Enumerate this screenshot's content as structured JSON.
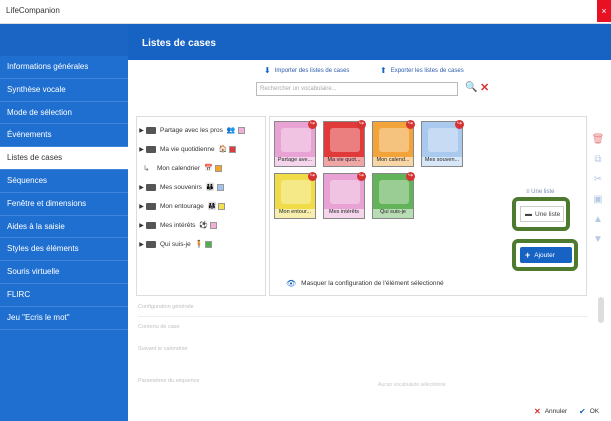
{
  "window": {
    "title": "LifeCompanion",
    "close_glyph": "×"
  },
  "sidebar": {
    "items": [
      {
        "label": "Informations générales",
        "active": false
      },
      {
        "label": "Synthèse vocale",
        "active": false
      },
      {
        "label": "Mode de sélection",
        "active": false
      },
      {
        "label": "Événements",
        "active": false
      },
      {
        "label": "Listes de cases",
        "active": true
      },
      {
        "label": "Séquences",
        "active": false
      },
      {
        "label": "Fenêtre et dimensions",
        "active": false
      },
      {
        "label": "Aides à la saisie",
        "active": false
      },
      {
        "label": "Styles des éléments",
        "active": false
      },
      {
        "label": "Souris virtuelle",
        "active": false
      },
      {
        "label": "FLIRC",
        "active": false
      },
      {
        "label": "Jeu \"Ecris le mot\"",
        "active": false
      }
    ]
  },
  "header": {
    "title": "Listes de cases"
  },
  "toolbar": {
    "import_label": "Importer des listes de cases",
    "export_label": "Exporter les listes de cases"
  },
  "search": {
    "placeholder": "Rechercher un vocabulaire..."
  },
  "tree": {
    "items": [
      {
        "label": "Partage avec les pros",
        "color": "#f2b0d9",
        "has_children": true,
        "fig": "👥"
      },
      {
        "label": "Ma vie quotidienne",
        "color": "#e03a3a",
        "has_children": true,
        "fig": "🏠"
      },
      {
        "label": "Mon calendrier",
        "color": "#f5a623",
        "has_children": false,
        "fig": "📅"
      },
      {
        "label": "Mes souvenirs",
        "color": "#9fc2ee",
        "has_children": true,
        "fig": "👪"
      },
      {
        "label": "Mon entourage",
        "color": "#f5e04a",
        "has_children": true,
        "fig": "👨‍👩‍👧"
      },
      {
        "label": "Mes intérêts",
        "color": "#f2b0d9",
        "has_children": true,
        "fig": "⚽"
      },
      {
        "label": "Qui suis-je",
        "color": "#4caf50",
        "has_children": true,
        "fig": "🧍"
      }
    ]
  },
  "tiles": [
    {
      "label": "Partage ave...",
      "color": "#e8a3d4"
    },
    {
      "label": "Ma vie quot...",
      "color": "#e03a3a"
    },
    {
      "label": "Mon calend...",
      "color": "#f2a43a"
    },
    {
      "label": "Mes souven...",
      "color": "#a9c9ee"
    },
    {
      "label": "Mon entour...",
      "color": "#f0dc48"
    },
    {
      "label": "Mes intérêts",
      "color": "#e8a3d4"
    },
    {
      "label": "Qui suis-je",
      "color": "#63b35a"
    }
  ],
  "buttons": {
    "une_liste": "Une liste",
    "ajouter": "Ajouter",
    "masquer": "Masquer la configuration de l'élément sélectionné",
    "annuler": "Annuler",
    "ok": "OK"
  },
  "config": {
    "labels": [
      "Configuration générale",
      "Contenu de case",
      "Suivant le calendrier",
      "Paramètres du séquence"
    ],
    "center_note": "Aucun vocabulaire sélectionné"
  },
  "colors": {
    "sidebar": "#1f6fd1",
    "header": "#1763c4",
    "highlight": "#4d7a2f"
  }
}
